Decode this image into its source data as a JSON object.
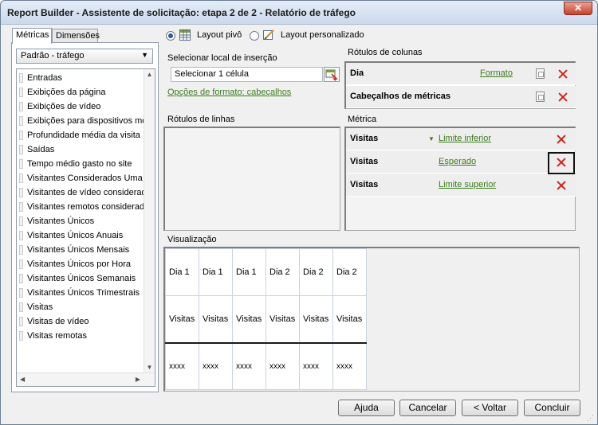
{
  "window": {
    "title": "Report Builder - Assistente de solicitação: etapa 2 de 2 - Relatório de tráfego",
    "close_label": "✕"
  },
  "left_panel": {
    "tabs": [
      {
        "label": "Métricas",
        "active": true
      },
      {
        "label": "Dimensões",
        "active": false
      }
    ],
    "dropdown_value": "Padrão - tráfego",
    "metrics": [
      "Entradas",
      "Exibições da página",
      "Exibições de vídeo",
      "Exibições para dispositivos móveis",
      "Profundidade média da visita",
      "Saídas",
      "Tempo médio gasto no site",
      "Visitantes Considerados Uma Vez n",
      "Visitantes de vídeo considerados u",
      "Visitantes remotos considerados um",
      "Visitantes Únicos",
      "Visitantes Únicos Anuais",
      "Visitantes Únicos Mensais",
      "Visitantes Únicos por Hora",
      "Visitantes Únicos Semanais",
      "Visitantes Únicos Trimestrais",
      "Visitas",
      "Visitas de vídeo",
      "Visitas remotas"
    ]
  },
  "layout": {
    "pivot_label": "Layout pivô",
    "pivot_selected": true,
    "custom_label": "Layout personalizado",
    "custom_selected": false
  },
  "insertion": {
    "heading": "Selecionar local de inserção",
    "cell_value": "Selecionar 1 célula",
    "format_link": "Opções de formato: cabeçalhos"
  },
  "columns": {
    "heading": "Rótulos de colunas",
    "items": [
      {
        "name": "Dia",
        "link": "Formato"
      },
      {
        "name": "Cabeçalhos de métricas",
        "link": ""
      }
    ]
  },
  "rows": {
    "heading": "Rótulos de linhas"
  },
  "metric_panel": {
    "heading": "Métrica",
    "items": [
      {
        "name": "Visitas",
        "value": "Limite inferior"
      },
      {
        "name": "Visitas",
        "value": "Esperado"
      },
      {
        "name": "Visitas",
        "value": "Limite superior"
      }
    ]
  },
  "preview": {
    "heading": "Visualização",
    "days": [
      "Dia 1",
      "Dia 1",
      "Dia 1",
      "Dia 2",
      "Dia 2",
      "Dia 2"
    ],
    "metrics": [
      "Visitas",
      "Visitas",
      "Visitas",
      "Visitas",
      "Visitas",
      "Visitas"
    ],
    "values": [
      "xxxx",
      "xxxx",
      "xxxx",
      "xxxx",
      "xxxx",
      "xxxx"
    ]
  },
  "buttons": {
    "help": "Ajuda",
    "cancel": "Cancelar",
    "back": "< Voltar",
    "finish": "Concluir"
  },
  "colors": {
    "link": "#3c7c1e",
    "delete": "#d0231c"
  }
}
